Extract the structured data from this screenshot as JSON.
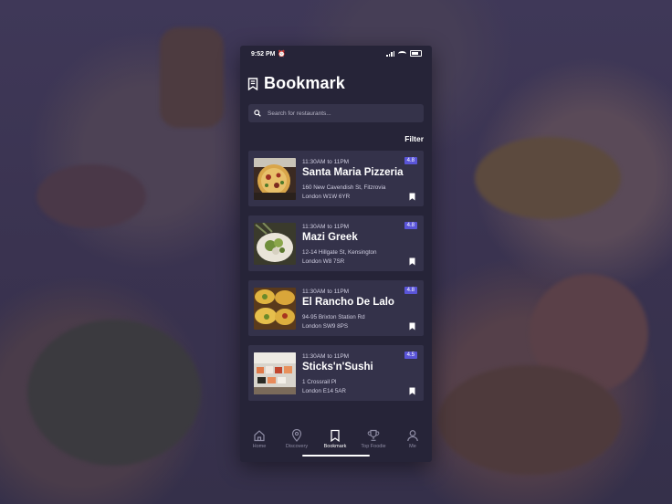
{
  "status_bar": {
    "time": "9:52 PM"
  },
  "header": {
    "title": "Bookmark"
  },
  "search": {
    "placeholder": "Search for restaurants..."
  },
  "filter_label": "Filter",
  "restaurants": [
    {
      "hours": "11:30AM to 11PM",
      "name": "Santa Maria Pizzeria",
      "address_line1": "160 New Cavendish St, Fitzrovia",
      "address_line2": "London W1W 6YR",
      "rating": "4.8"
    },
    {
      "hours": "11:30AM to 11PM",
      "name": "Mazi Greek",
      "address_line1": "12-14 Hillgate St, Kensington",
      "address_line2": "London W8 7SR",
      "rating": "4.8"
    },
    {
      "hours": "11:30AM to 11PM",
      "name": "El Rancho De Lalo",
      "address_line1": "94-95 Brixton Station Rd",
      "address_line2": "London SW9 8PS",
      "rating": "4.8"
    },
    {
      "hours": "11:30AM to 11PM",
      "name": "Sticks'n'Sushi",
      "address_line1": "1 Crossrail Pl",
      "address_line2": "London E14 5AR",
      "rating": "4.5"
    }
  ],
  "tabs": [
    {
      "label": "Home",
      "icon": "home-icon"
    },
    {
      "label": "Discovery",
      "icon": "map-pin-icon"
    },
    {
      "label": "Bookmark",
      "icon": "bookmark-icon",
      "active": true
    },
    {
      "label": "Top Foodie",
      "icon": "trophy-icon"
    },
    {
      "label": "Me",
      "icon": "user-icon"
    }
  ],
  "colors": {
    "phone_bg": "#262438",
    "card_bg": "#34324a",
    "rating_badge": "#5a55d8",
    "inactive_tab": "#8e8ca4"
  }
}
